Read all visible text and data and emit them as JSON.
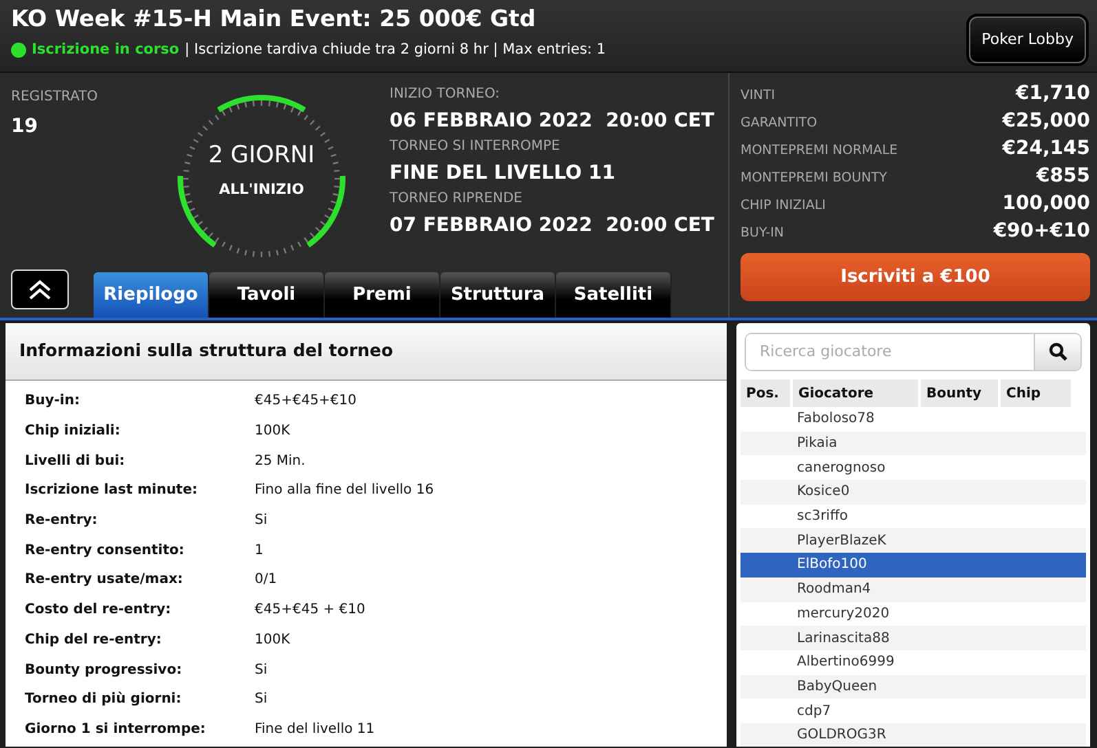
{
  "header": {
    "title": "KO Week #15-H Main Event: 25 000€ Gtd",
    "status": {
      "text": "Iscrizione in corso",
      "on": true
    },
    "details": "| Iscrizione tardiva chiude tra 2 giorni 8 hr | Max entries: 1",
    "lobby_button": "Poker Lobby"
  },
  "registered": {
    "label": "REGISTRATO",
    "value": "19"
  },
  "countdown": {
    "value": "2 GIORNI",
    "caption": "ALL'INIZIO"
  },
  "schedule": [
    {
      "label": "INIZIO TORNEO:",
      "value": "06 FEBBRAIO 2022  20:00 CET"
    },
    {
      "label": "TORNEO SI INTERROMPE",
      "value": "FINE DEL LIVELLO 11"
    },
    {
      "label": "TORNEO RIPRENDE",
      "value": "07 FEBBRAIO 2022  20:00 CET"
    }
  ],
  "stats": [
    {
      "label": "VINTI",
      "value": "€1,710"
    },
    {
      "label": "GARANTITO",
      "value": "€25,000"
    },
    {
      "label": "MONTEPREMI NORMALE",
      "value": "€24,145"
    },
    {
      "label": "MONTEPREMI BOUNTY",
      "value": "€855"
    },
    {
      "label": "CHIP INIZIALI",
      "value": "100,000"
    },
    {
      "label": "BUY-IN",
      "value": "€90+€10"
    }
  ],
  "register_button": "Iscriviti a €100",
  "tabs": [
    {
      "label": "Riepilogo",
      "selected": true
    },
    {
      "label": "Tavoli",
      "selected": false
    },
    {
      "label": "Premi",
      "selected": false
    },
    {
      "label": "Struttura",
      "selected": false
    },
    {
      "label": "Satelliti",
      "selected": false
    }
  ],
  "info_panel": {
    "title": "Informazioni sulla struttura del torneo",
    "rows": [
      {
        "label": "Buy-in:",
        "value": "€45+€45+€10"
      },
      {
        "label": "Chip iniziali:",
        "value": "100K"
      },
      {
        "label": "Livelli di bui:",
        "value": "25 Min."
      },
      {
        "label": "Iscrizione last minute:",
        "value": "Fino alla fine del livello 16"
      },
      {
        "label": "Re-entry:",
        "value": "Si"
      },
      {
        "label": "Re-entry consentito:",
        "value": "1"
      },
      {
        "label": "Re-entry usate/max:",
        "value": "0/1"
      },
      {
        "label": "Costo del re-entry:",
        "value": "€45+€45 + €10"
      },
      {
        "label": "Chip del re-entry:",
        "value": "100K"
      },
      {
        "label": "Bounty progressivo:",
        "value": "Si"
      },
      {
        "label": "Torneo di più giorni:",
        "value": "Si"
      },
      {
        "label": "Giorno 1 si interrompe:",
        "value": "Fine del livello 11"
      }
    ]
  },
  "players": {
    "search": {
      "placeholder": "Ricerca giocatore"
    },
    "columns": [
      "Pos.",
      "Giocatore",
      "Bounty",
      "Chip"
    ],
    "rows": [
      {
        "name": "Faboloso78",
        "selected": false
      },
      {
        "name": "Pikaia",
        "selected": false
      },
      {
        "name": "canerognoso",
        "selected": false
      },
      {
        "name": "Kosice0",
        "selected": false
      },
      {
        "name": "sc3riffo",
        "selected": false
      },
      {
        "name": "PlayerBlazeK",
        "selected": false
      },
      {
        "name": "ElBofo100",
        "selected": true
      },
      {
        "name": "Roodman4",
        "selected": false
      },
      {
        "name": "mercury2020",
        "selected": false
      },
      {
        "name": "Larinascita88",
        "selected": false
      },
      {
        "name": "Albertino6999",
        "selected": false
      },
      {
        "name": "BabyQueen",
        "selected": false
      },
      {
        "name": "cdp7",
        "selected": false
      },
      {
        "name": "GOLDROG3R",
        "selected": false
      }
    ]
  }
}
